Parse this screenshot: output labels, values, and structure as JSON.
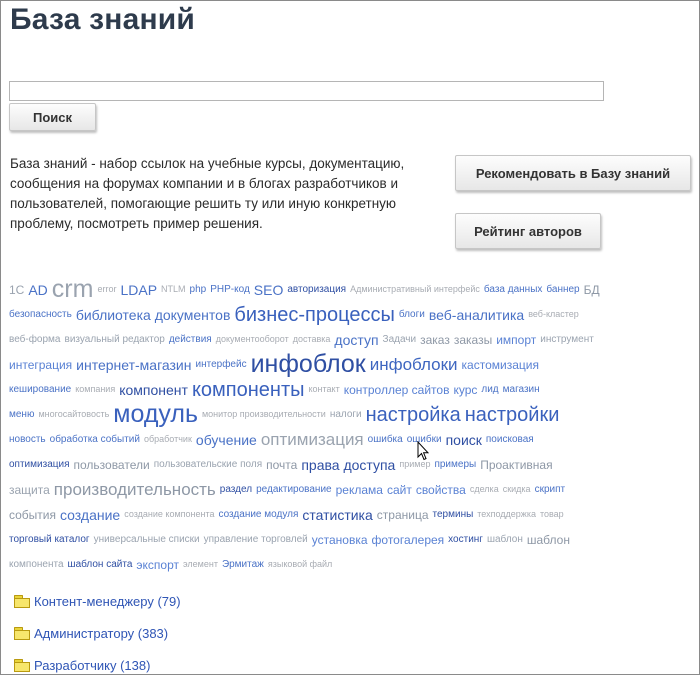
{
  "page": {
    "title": "База знаний"
  },
  "search": {
    "placeholder": "",
    "button_label": "Поиск"
  },
  "description": "База знаний - набор ссылок на учебные курсы, документацию, сообщения на форумах компании и в блогах разработчиков и пользователей, помогающие решить ту или иную конкретную проблему, посмотреть пример решения.",
  "buttons": {
    "recommend": "Рекомендовать в Базу знаний",
    "rating": "Рейтинг авторов"
  },
  "tag_rows": [
    [
      [
        "1С",
        "s3 g1"
      ],
      [
        "AD",
        "s4"
      ],
      [
        "crm",
        "s7 g1"
      ],
      [
        "error",
        "s1"
      ],
      [
        "LDAP",
        "s4"
      ],
      [
        "NTLM",
        "s1"
      ],
      [
        "php",
        "s2"
      ],
      [
        "PHP-код",
        "s2"
      ],
      [
        "SEO",
        "s4"
      ],
      [
        "авторизация",
        "s2 d"
      ],
      [
        "Административный интерфейс",
        "s1"
      ],
      [
        "база данных",
        "s2"
      ],
      [
        "баннер",
        "s2"
      ],
      [
        "БД",
        "s3 g2"
      ]
    ],
    [
      [
        "безопасность",
        "s2"
      ],
      [
        "библиотека документов",
        "s4"
      ],
      [
        "бизнес-процессы",
        "s6"
      ],
      [
        "блоги",
        "s2"
      ],
      [
        "веб-аналитика",
        "s4"
      ],
      [
        "веб-кластер",
        "s1"
      ]
    ],
    [
      [
        "веб-форма",
        "s2 g1"
      ],
      [
        "визуальный редактор",
        "s2 g1"
      ],
      [
        "действия",
        "s2"
      ],
      [
        "документооборот",
        "s1"
      ],
      [
        "доставка",
        "s1"
      ],
      [
        "доступ",
        "s4"
      ],
      [
        "Задачи",
        "s2 g1"
      ],
      [
        "заказ",
        "s3 g2"
      ],
      [
        "заказы",
        "s3 g2"
      ],
      [
        "импорт",
        "s3"
      ],
      [
        "инструмент",
        "s2 g1"
      ]
    ],
    [
      [
        "интеграция",
        "s3"
      ],
      [
        "интернет-магазин",
        "s4"
      ],
      [
        "интерфейс",
        "s2"
      ],
      [
        "инфоблок",
        "s7 d"
      ],
      [
        "инфоблоки",
        "s5"
      ],
      [
        "кастомизация",
        "s3"
      ]
    ],
    [
      [
        "кеширование",
        "s2"
      ],
      [
        "компания",
        "s1"
      ],
      [
        "компонент",
        "s4 d"
      ],
      [
        "компоненты",
        "s6"
      ],
      [
        "контакт",
        "s1"
      ],
      [
        "контроллер сайтов",
        "s3"
      ],
      [
        "курс",
        "s3"
      ],
      [
        "лид",
        "s2"
      ],
      [
        "магазин",
        "s2"
      ]
    ],
    [
      [
        "меню",
        "s2"
      ],
      [
        "многосайтовость",
        "s1"
      ],
      [
        "модуль",
        "s7"
      ],
      [
        "монитор производительности",
        "s1"
      ],
      [
        "налоги",
        "s2 g1"
      ],
      [
        "настройка",
        "s6"
      ],
      [
        "настройки",
        "s6"
      ]
    ],
    [
      [
        "новость",
        "s2"
      ],
      [
        "обработка событий",
        "s2"
      ],
      [
        "обработчик",
        "s1"
      ],
      [
        "обучение",
        "s4"
      ],
      [
        "оптимизация",
        "s5 g1"
      ],
      [
        "ошибка",
        "s2"
      ],
      [
        "ошибки",
        "s2"
      ],
      [
        "поиск",
        "s4 d"
      ],
      [
        "поисковая",
        "s2"
      ]
    ],
    [
      [
        "оптимизация",
        "s2 d"
      ],
      [
        "пользователи",
        "s3 g2"
      ],
      [
        "пользовательские поля",
        "s2 g1"
      ],
      [
        "почта",
        "s3 g2"
      ],
      [
        "права доступа",
        "s4 d"
      ],
      [
        "пример",
        "s1"
      ],
      [
        "примеры",
        "s2"
      ],
      [
        "Проактивная",
        "s3 g2"
      ]
    ],
    [
      [
        "защита",
        "s3 g1"
      ],
      [
        "производительность",
        "s5 g2"
      ],
      [
        "раздел",
        "s2 d"
      ],
      [
        "редактирование",
        "s2"
      ],
      [
        "реклама",
        "s3"
      ],
      [
        "сайт",
        "s3"
      ],
      [
        "свойства",
        "s3"
      ],
      [
        "сделка",
        "s1"
      ],
      [
        "скидка",
        "s1"
      ],
      [
        "скрипт",
        "s2"
      ]
    ],
    [
      [
        "события",
        "s3 g2"
      ],
      [
        "создание",
        "s4"
      ],
      [
        "создание компонента",
        "s1"
      ],
      [
        "создание модуля",
        "s2"
      ],
      [
        "статистика",
        "s4 d"
      ],
      [
        "страница",
        "s3 g2"
      ],
      [
        "термины",
        "s2 d"
      ],
      [
        "техподдержка",
        "s1"
      ],
      [
        "товар",
        "s1"
      ]
    ],
    [
      [
        "торговый каталог",
        "s2 d"
      ],
      [
        "универсальные списки",
        "s2 g1"
      ],
      [
        "управление торговлей",
        "s2 g1"
      ],
      [
        "установка",
        "s3"
      ],
      [
        "фотогалерея",
        "s3"
      ],
      [
        "хостинг",
        "s2 d"
      ],
      [
        "шаблон",
        "s2 g1"
      ],
      [
        "шаблон",
        "s3 g2"
      ]
    ],
    [
      [
        "компонента",
        "s2 g1"
      ],
      [
        "шаблон сайта",
        "s2 d"
      ],
      [
        "экспорт",
        "s3"
      ],
      [
        "элемент",
        "s1"
      ],
      [
        "Эрмитаж",
        "s2"
      ],
      [
        "языковой файл",
        "s1"
      ]
    ]
  ],
  "categories": [
    {
      "label": "Контент-менеджеру (79)"
    },
    {
      "label": "Администратору (383)"
    },
    {
      "label": "Разработчику (138)"
    }
  ],
  "colors": {
    "title": "#2e3b4c",
    "tag": "#4a72c6",
    "tag_muted": "#a8acb3",
    "link": "#2f55b5",
    "folder": "#f7e66c"
  }
}
